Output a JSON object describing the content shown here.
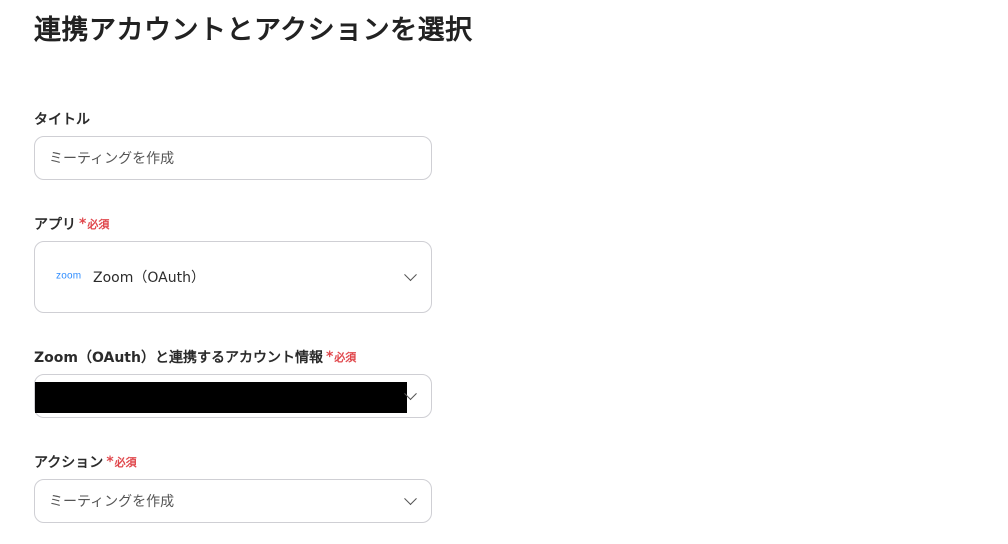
{
  "page": {
    "title": "連携アカウントとアクションを選択"
  },
  "fields": {
    "title": {
      "label": "タイトル",
      "value": "ミーティングを作成"
    },
    "app": {
      "label": "アプリ",
      "required_mark": "*",
      "required_text": "必須",
      "logo_text": "zoom",
      "value": "Zoom（OAuth）"
    },
    "account": {
      "label": "Zoom（OAuth）と連携するアカウント情報",
      "required_mark": "*",
      "required_text": "必須"
    },
    "action": {
      "label": "アクション",
      "required_mark": "*",
      "required_text": "必須",
      "value": "ミーティングを作成"
    }
  },
  "colors": {
    "required": "#e0474c",
    "zoom_blue": "#2d8cff",
    "border": "#cfcfd4"
  },
  "icons": {
    "dropdown": "chevron-down-icon",
    "app_logo": "zoom-logo-icon"
  }
}
